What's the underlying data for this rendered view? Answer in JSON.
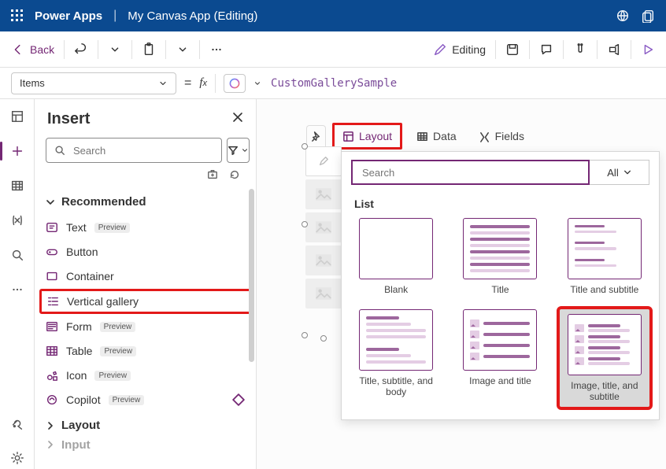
{
  "title": {
    "brand": "Power Apps",
    "app": "My Canvas App (Editing)"
  },
  "toolbar": {
    "back": "Back",
    "editing": "Editing"
  },
  "formula": {
    "property": "Items",
    "value": "CustomGallerySample"
  },
  "insert": {
    "title": "Insert",
    "search_ph": "Search",
    "sections": {
      "recommended": {
        "label": "Recommended",
        "items": [
          {
            "label": "Text",
            "preview": "Preview",
            "icon": "text"
          },
          {
            "label": "Button",
            "preview": "",
            "icon": "button"
          },
          {
            "label": "Container",
            "preview": "",
            "icon": "container"
          },
          {
            "label": "Vertical gallery",
            "preview": "",
            "icon": "vgallery",
            "hl": true
          },
          {
            "label": "Form",
            "preview": "Preview",
            "icon": "form"
          },
          {
            "label": "Table",
            "preview": "Preview",
            "icon": "table"
          },
          {
            "label": "Icon",
            "preview": "Preview",
            "icon": "iconshape"
          },
          {
            "label": "Copilot",
            "preview": "Preview",
            "icon": "copilot",
            "diamond": true
          }
        ]
      },
      "layout": {
        "label": "Layout"
      },
      "input": {
        "label": "Input"
      }
    }
  },
  "options": {
    "layout": "Layout",
    "data": "Data",
    "fields": "Fields"
  },
  "layout_panel": {
    "search_ph": "Search",
    "all": "All",
    "list_label": "List",
    "cards": [
      {
        "label": "Blank",
        "type": "blank"
      },
      {
        "label": "Title",
        "type": "lines"
      },
      {
        "label": "Title and subtitle",
        "type": "linesub"
      },
      {
        "label": "Title, subtitle, and body",
        "type": "linesbody"
      },
      {
        "label": "Image and title",
        "type": "img1"
      },
      {
        "label": "Image, title, and subtitle",
        "type": "img2",
        "hl": true
      }
    ]
  }
}
